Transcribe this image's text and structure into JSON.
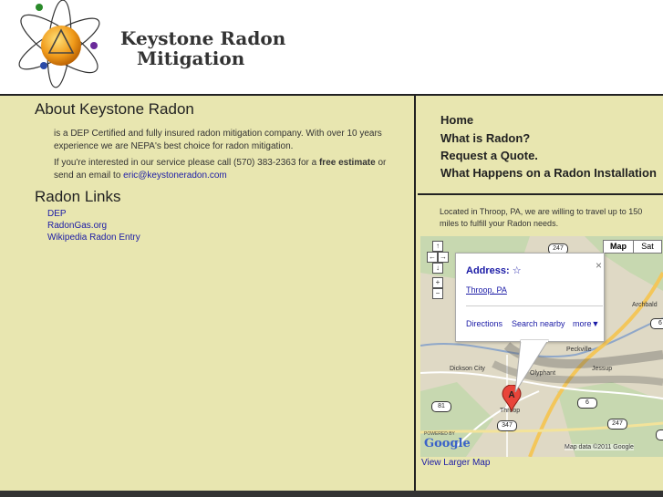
{
  "header": {
    "logo_line1": "Keystone Radon",
    "logo_line2": "Mitigation"
  },
  "about": {
    "heading": "About Keystone Radon",
    "para1": "is a DEP Certified and fully insured radon mitigation company. With over 10 years experience we are NEPA's best choice for radon mitigation.",
    "para2_prefix": "If you're interested in our service please call (570) 383-2363 for a ",
    "para2_bold": "free estimate",
    "para2_mid": " or send an email to ",
    "para2_email": "eric@keystoneradon.com"
  },
  "links": {
    "heading": "Radon Links",
    "items": [
      "DEP",
      "RadonGas.org",
      "Wikipedia Radon Entry"
    ]
  },
  "nav": {
    "items": [
      "Home",
      "What is Radon?",
      "Request a Quote.",
      "What Happens on a Radon Installation"
    ]
  },
  "location_text": "Located in Throop, PA, we are willing to travel up to 150 miles to fulfill your Radon needs.",
  "map": {
    "tab_map": "Map",
    "tab_sat": "Sat",
    "infowindow": {
      "title": "Address:",
      "address": "Throop, PA",
      "close": "×",
      "links": [
        "Directions",
        "Search nearby",
        "more▼"
      ]
    },
    "marker_label": "A",
    "places": [
      "Archbald",
      "Peckville",
      "Dickson City",
      "Olyphant",
      "Jessup",
      "Throop"
    ],
    "shields": [
      "247",
      "6",
      "6",
      "247",
      "347",
      "81",
      "6"
    ],
    "powered_by": "POWERED BY",
    "google": "Google",
    "attribution": "Map data ©2011 Google",
    "larger_map": "View Larger Map"
  },
  "colors": {
    "content_bg": "#e8e6b0",
    "link": "#1a1aa6",
    "footer": "#333333"
  }
}
